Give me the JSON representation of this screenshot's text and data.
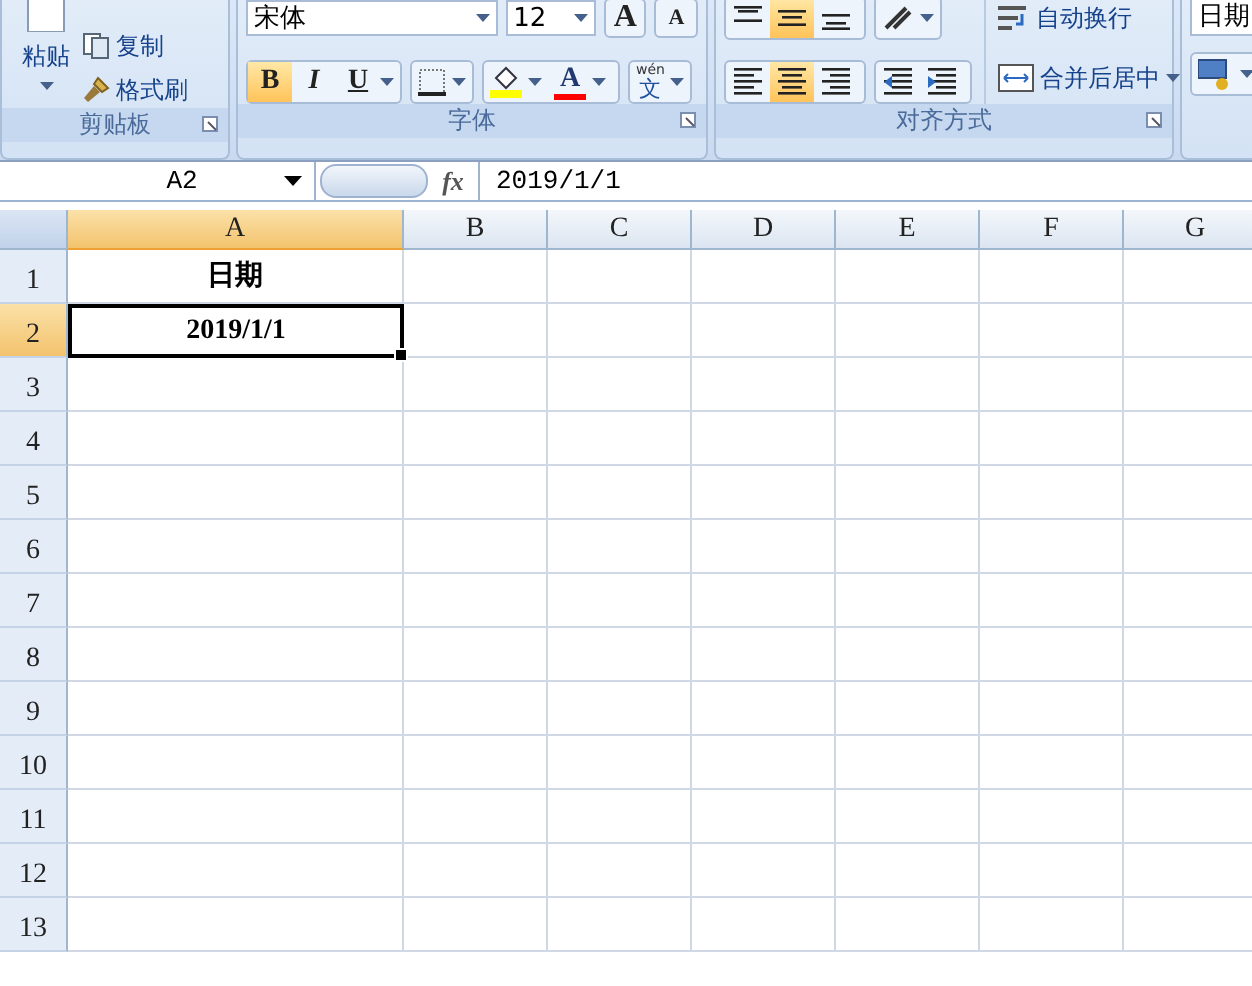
{
  "ribbon": {
    "groups": [
      {
        "kind": "clipboard",
        "label": "剪贴板",
        "paste": "粘贴",
        "copy": "复制",
        "format_painter": "格式刷"
      },
      {
        "kind": "font",
        "label": "字体",
        "font_name": "宋体",
        "font_size": "12",
        "grow": "A",
        "shrink": "A",
        "styles": [
          {
            "kind": "bold",
            "label": "B",
            "selected": true
          },
          {
            "kind": "italic",
            "label": "I",
            "selected": false
          },
          {
            "kind": "underline",
            "label": "U",
            "selected": false
          }
        ],
        "fill_color": {
          "color": "#ffff00"
        },
        "font_color": {
          "label": "A",
          "color": "#ff0000"
        },
        "phonetic": {
          "top": "wén",
          "glyph": "文"
        }
      },
      {
        "kind": "alignment",
        "label": "对齐方式",
        "vertical": [
          {
            "kind": "top",
            "selected": false
          },
          {
            "kind": "middle",
            "selected": true
          },
          {
            "kind": "bottom",
            "selected": false
          }
        ],
        "horizontal": [
          {
            "kind": "left",
            "selected": false
          },
          {
            "kind": "center",
            "selected": true
          },
          {
            "kind": "right",
            "selected": false
          }
        ],
        "wrap": "自动换行",
        "merge": "合并后居中"
      },
      {
        "kind": "number",
        "format": "日期"
      }
    ]
  },
  "formula_bar": {
    "name_box": "A2",
    "fx": "fx",
    "value": "2019/1/1"
  },
  "sheet": {
    "columns": [
      {
        "label": "A",
        "selected": true
      },
      {
        "label": "B",
        "selected": false
      },
      {
        "label": "C",
        "selected": false
      },
      {
        "label": "D",
        "selected": false
      },
      {
        "label": "E",
        "selected": false
      },
      {
        "label": "F",
        "selected": false
      },
      {
        "label": "G",
        "selected": false
      }
    ],
    "rows": [
      {
        "label": "1",
        "selected": false,
        "cells": [
          {
            "text": "日期",
            "active": false
          }
        ]
      },
      {
        "label": "2",
        "selected": true,
        "cells": [
          {
            "text": "2019/1/1",
            "active": true
          }
        ]
      },
      {
        "label": "3",
        "selected": false
      },
      {
        "label": "4",
        "selected": false
      },
      {
        "label": "5",
        "selected": false
      },
      {
        "label": "6",
        "selected": false
      },
      {
        "label": "7",
        "selected": false
      },
      {
        "label": "8",
        "selected": false
      },
      {
        "label": "9",
        "selected": false
      },
      {
        "label": "10",
        "selected": false
      },
      {
        "label": "11",
        "selected": false
      },
      {
        "label": "12",
        "selected": false
      },
      {
        "label": "13",
        "selected": false
      }
    ]
  }
}
